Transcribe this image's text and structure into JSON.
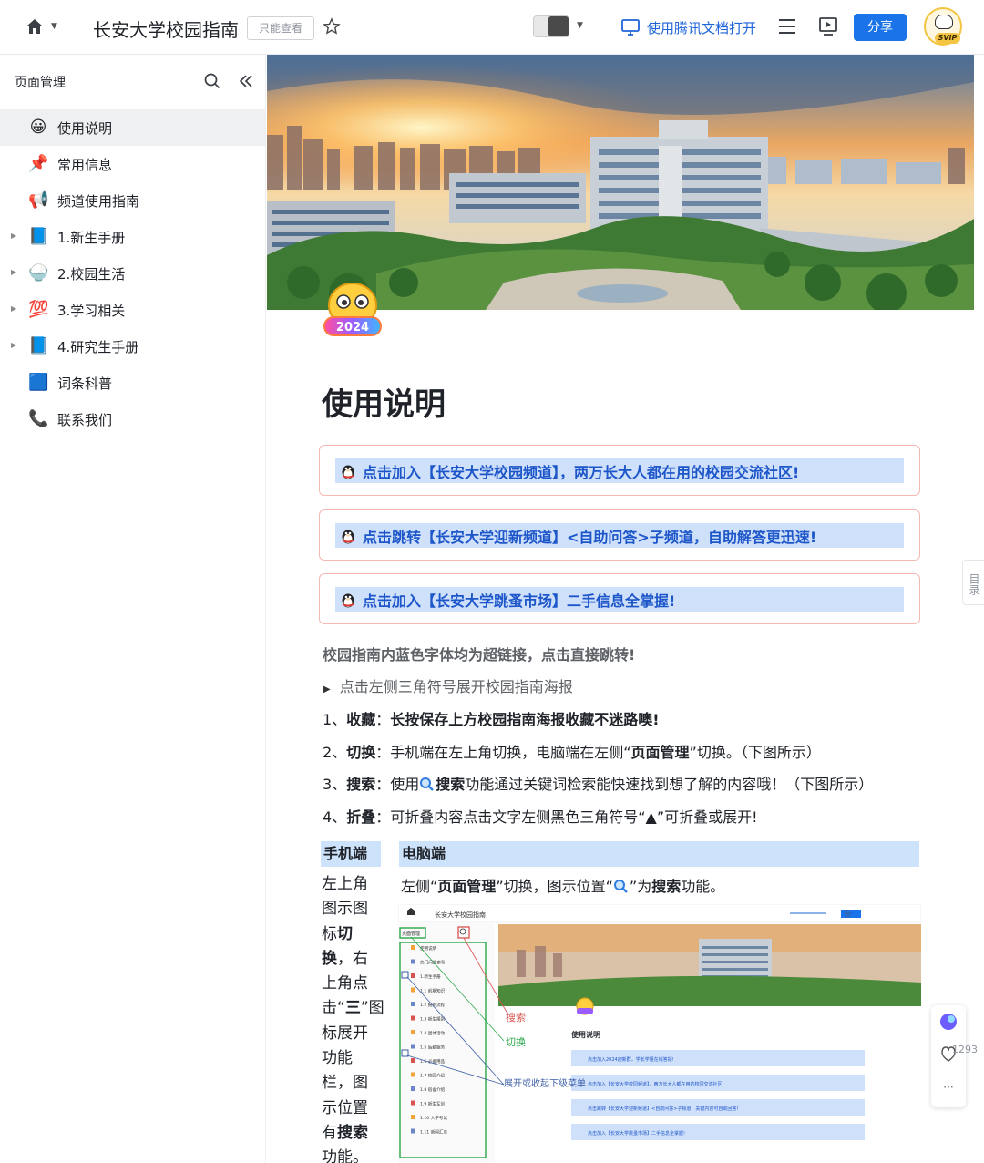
{
  "topbar": {
    "doc_title": "长安大学校园指南",
    "readonly_label": "只能查看",
    "open_tencent_label": "使用腾讯文档打开",
    "share_label": "分享",
    "svip_label": "SVIP"
  },
  "sidebar": {
    "header": "页面管理",
    "items": [
      {
        "label": "使用说明",
        "icon": "😀",
        "expandable": false,
        "active": true
      },
      {
        "label": "常用信息",
        "icon": "📌",
        "expandable": false,
        "active": false
      },
      {
        "label": "频道使用指南",
        "icon": "📢",
        "expandable": false,
        "active": false
      },
      {
        "label": "1.新生手册",
        "icon": "📘",
        "expandable": true,
        "active": false
      },
      {
        "label": "2.校园生活",
        "icon": "🍚",
        "expandable": true,
        "active": false
      },
      {
        "label": "3.学习相关",
        "icon": "💯",
        "expandable": true,
        "active": false
      },
      {
        "label": "4.研究生手册",
        "icon": "📘",
        "expandable": true,
        "active": false
      },
      {
        "label": "词条科普",
        "icon": "🟦",
        "expandable": false,
        "active": false
      },
      {
        "label": "联系我们",
        "icon": "📞",
        "expandable": false,
        "active": false
      }
    ]
  },
  "doc": {
    "emoji_year": "2024",
    "heading": "使用说明",
    "callouts": [
      "点击加入【长安大学校园频道】，两万长大人都在用的校园交流社区!",
      "点击跳转【长安大学迎新频道】<自助问答>子频道，自助解答更迅速!",
      "点击加入【长安大学跳蚤市场】二手信息全掌握!"
    ],
    "note_bold": "校园指南内蓝色字体均为超链接，点击直接跳转!",
    "toggle_text": "点击左侧三角符号展开校园指南海报",
    "steps": [
      {
        "num": "1、",
        "key": "收藏",
        "sep": "：",
        "rest": "",
        "tail_bold": "长按保存上方校园指南海报收藏不迷路噢!"
      },
      {
        "num": "2、",
        "key": "切换",
        "sep": "：",
        "rest": "手机端在左上角切换，电脑端在左侧“",
        "mid_bold": "页面管理",
        "tail": "”切换。（下图所示）"
      },
      {
        "num": "3、",
        "key": "搜索",
        "sep": "：",
        "rest": "使用",
        "mid_bold": "搜索",
        "tail": "功能通过关键词检索能快速找到想了解的内容哦！（下图所示）"
      },
      {
        "num": "4、",
        "key": "折叠",
        "sep": "：",
        "rest": "可折叠内容点击文字左侧黑色三角符号“▲”可折叠或展开!"
      }
    ],
    "col_left_head": "手机端",
    "col_right_head": "电脑端",
    "mobile_desc_a": "左上角图示图标",
    "mobile_desc_b": "切换",
    "mobile_desc_c": "，右上角点击“",
    "mobile_desc_d": "三",
    "mobile_desc_e": "”图标展开功能栏，图示位置有",
    "mobile_desc_f": "搜索",
    "mobile_desc_g": "功能。",
    "pc_desc_a": "左侧“",
    "pc_desc_b": "页面管理",
    "pc_desc_c": "”切换，图示位置“",
    "pc_desc_d": "”为",
    "pc_desc_e": "搜索",
    "pc_desc_f": "功能。"
  },
  "screenshot": {
    "title": "长安大学校园指南",
    "sidebar_header": "页面管理",
    "heading": "使用说明",
    "annot_search": "搜索",
    "annot_switch": "切换",
    "annot_expand": "展开或收起下级菜单",
    "items": [
      "使用说明",
      "热门问题索引",
      "1.新生手册",
      "1.1 前期知识",
      "1.2 报到流程",
      "1.3 新生报到",
      "1.4 团体活动",
      "1.5 后勤服务",
      "1.6 必备用品",
      "1.7 校园介绍",
      "1.8 宿舍介绍",
      "1.9 新生军训",
      "1.10 入学考试",
      "1.11 新闻汇总"
    ],
    "callouts": [
      "点击加入2024迎新群，学长学姐在线答疑!",
      "点击加入【长安大学校园频道】，两万长大人都在用的校园交流社区!",
      "点击跳转【长安大学迎新频道】<自助问答>子频道，关键内容可自助回答!",
      "点击加入【长安大学跳蚤市场】二手信息全掌握!"
    ]
  },
  "right_rail": {
    "toc_label": "目录",
    "like_count": "1293",
    "more_label": "···"
  },
  "colors": {
    "link_blue": "#1d56c9",
    "callout_bg": "#cfe0fb",
    "callout_border": "#f3b9b2",
    "share_blue": "#1a73e8",
    "header_col_bg": "#cde3fb"
  }
}
